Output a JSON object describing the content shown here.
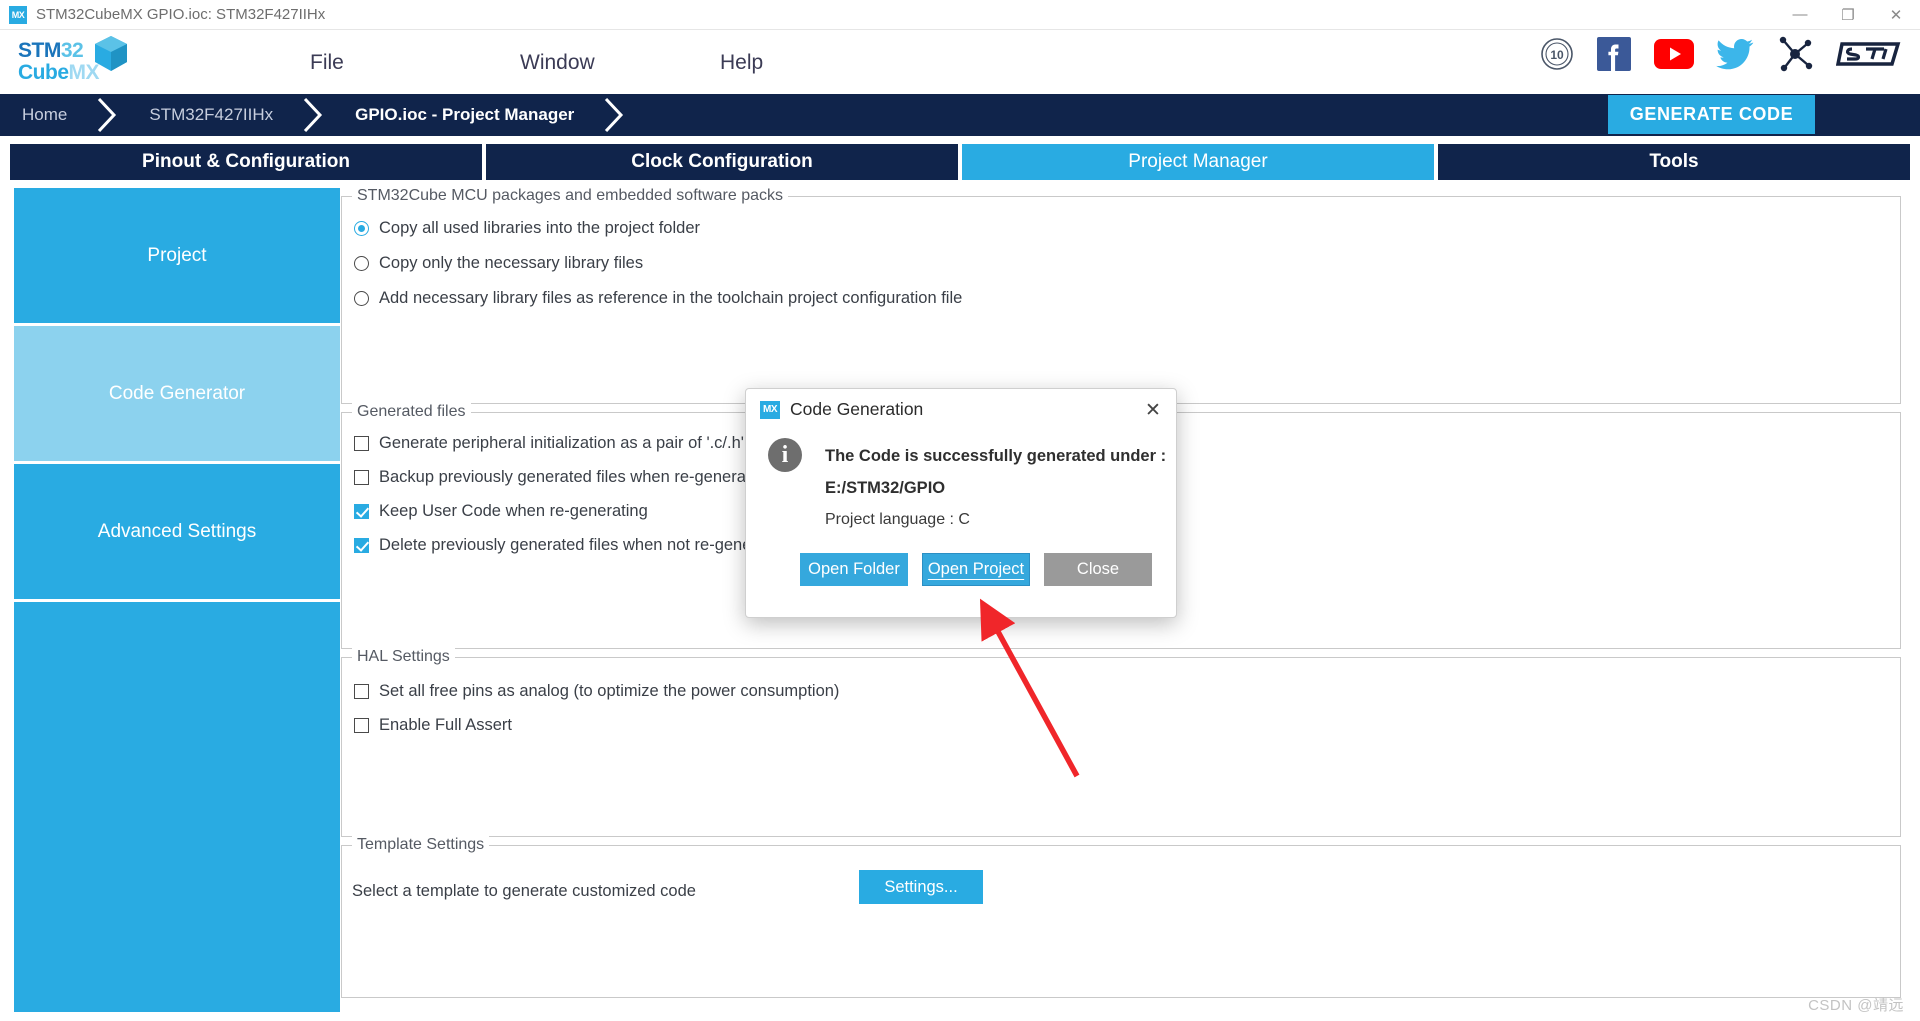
{
  "window": {
    "icon": "mx-app-icon",
    "icon_text": "MX",
    "title": "STM32CubeMX GPIO.ioc: STM32F427IIHx",
    "minimize": "—",
    "maximize": "❐",
    "close": "✕"
  },
  "logo": {
    "line1_a": "STM",
    "line1_b": "32",
    "line2_a": "Cube",
    "line2_b": "MX"
  },
  "menu": {
    "items": [
      "File",
      "Window",
      "Help"
    ]
  },
  "social": {
    "items": [
      {
        "name": "anniversary-10-icon",
        "label": "10"
      },
      {
        "name": "facebook-icon",
        "label": "f"
      },
      {
        "name": "youtube-icon",
        "label": "▶"
      },
      {
        "name": "twitter-icon",
        "label": "twitter"
      },
      {
        "name": "community-icon",
        "label": "community"
      },
      {
        "name": "st-logo-icon",
        "label": "ST"
      }
    ]
  },
  "breadcrumb": {
    "items": [
      {
        "label": "Home",
        "active": false
      },
      {
        "label": "STM32F427IIHx",
        "active": false
      },
      {
        "label": "GPIO.ioc - Project Manager",
        "active": true
      }
    ],
    "generate_code": "GENERATE CODE"
  },
  "tabs": [
    {
      "label": "Pinout & Configuration",
      "active": false
    },
    {
      "label": "Clock Configuration",
      "active": false
    },
    {
      "label": "Project Manager",
      "active": true
    },
    {
      "label": "Tools",
      "active": false
    }
  ],
  "rail": [
    {
      "label": "Project",
      "active": false
    },
    {
      "label": "Code Generator",
      "active": true
    },
    {
      "label": "Advanced Settings",
      "active": false
    },
    {
      "label": "",
      "active": false
    }
  ],
  "groups": {
    "packages": {
      "title": "STM32Cube MCU packages and embedded software packs",
      "options": [
        {
          "label": "Copy all used libraries into the project folder",
          "selected": true
        },
        {
          "label": "Copy only the necessary library files",
          "selected": false
        },
        {
          "label": "Add necessary library files as reference in the toolchain project configuration file",
          "selected": false
        }
      ]
    },
    "generated_files": {
      "title": "Generated files",
      "options": [
        {
          "label": "Generate peripheral initialization as a pair of '.c/.h' files per peripheral",
          "checked": false
        },
        {
          "label": "Backup previously generated files when re-generating",
          "checked": false
        },
        {
          "label": "Keep User Code when re-generating",
          "checked": true
        },
        {
          "label": "Delete previously generated files when not re-generated",
          "checked": true
        }
      ]
    },
    "hal_settings": {
      "title": "HAL Settings",
      "options": [
        {
          "label": "Set all free pins as analog (to optimize the power consumption)",
          "checked": false
        },
        {
          "label": "Enable Full Assert",
          "checked": false
        }
      ]
    },
    "template_settings": {
      "title": "Template Settings",
      "description": "Select a template to generate customized code",
      "button": "Settings..."
    }
  },
  "dialog": {
    "icon_text": "MX",
    "title": "Code Generation",
    "close": "✕",
    "info_glyph": "i",
    "message_line1": "The Code is successfully generated under :",
    "message_line2": "E:/STM32/GPIO",
    "message_line3": "Project language : C",
    "buttons": [
      {
        "label": "Open Folder",
        "style": "blue",
        "focused": false
      },
      {
        "label": "Open Project",
        "style": "blue",
        "focused": true
      },
      {
        "label": "Close",
        "style": "grey",
        "focused": false
      }
    ]
  },
  "annotation": {
    "arrow_color": "#f0262a"
  },
  "watermark": "CSDN @靖远"
}
